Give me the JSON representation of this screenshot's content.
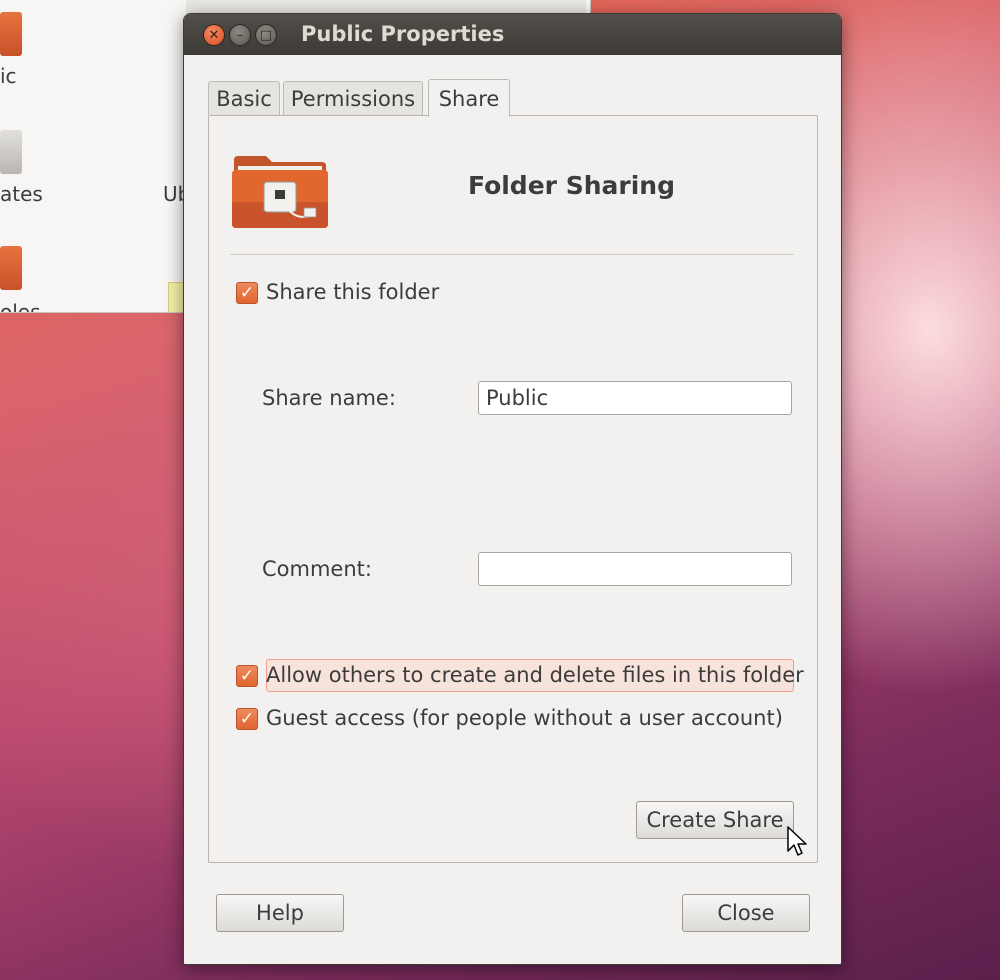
{
  "background_window": {
    "labels": [
      "ic",
      "ates",
      "Ub",
      "oles"
    ]
  },
  "dialog": {
    "title": "Public Properties",
    "tabs": [
      {
        "label": "Basic",
        "active": false
      },
      {
        "label": "Permissions",
        "active": false
      },
      {
        "label": "Share",
        "active": true
      }
    ],
    "heading": "Folder Sharing",
    "share_this_folder": {
      "label": "Share this folder",
      "checked": true
    },
    "share_name": {
      "label": "Share name:",
      "value": "Public"
    },
    "comment": {
      "label": "Comment:",
      "value": ""
    },
    "allow_others": {
      "label": "Allow others to create and delete files in this folder",
      "checked": true
    },
    "guest_access": {
      "label": "Guest access (for people without a user account)",
      "checked": true
    },
    "create_share_label": "Create Share",
    "help_label": "Help",
    "close_label": "Close"
  },
  "colors": {
    "accent": "#df6530",
    "titlebar": "#3d3b37",
    "close_button": "#d94d1f"
  }
}
